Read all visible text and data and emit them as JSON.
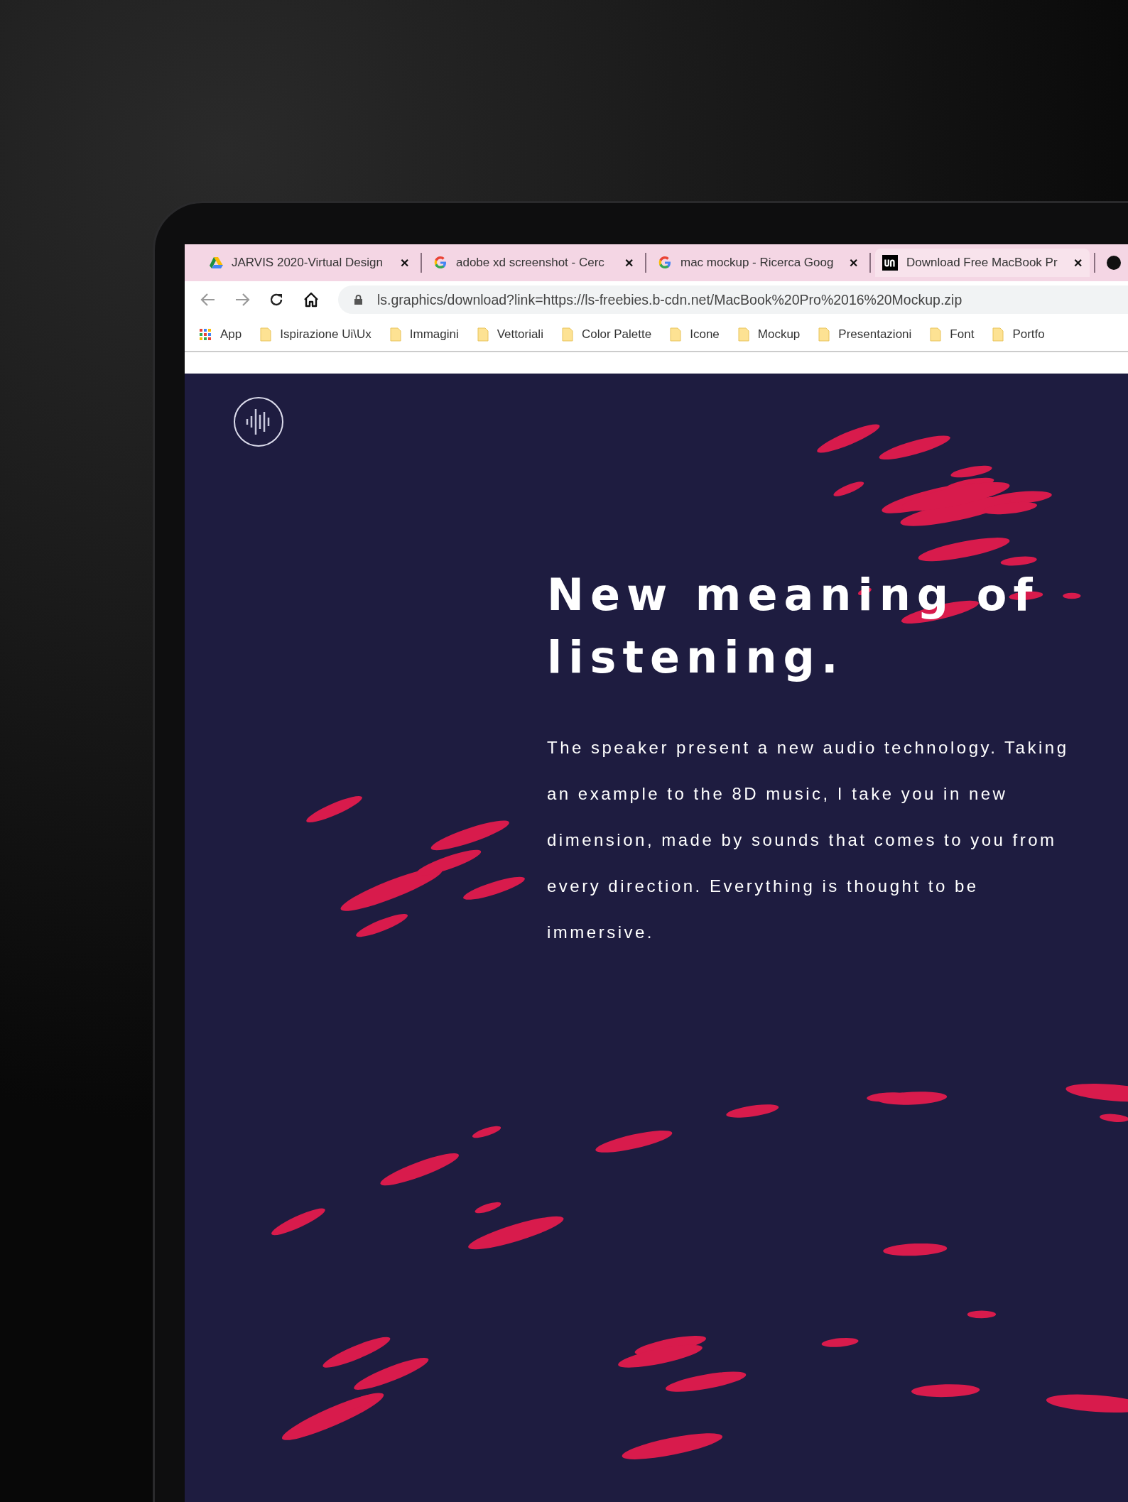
{
  "browser": {
    "tabs": [
      {
        "title": "JARVIS 2020-Virtual Design",
        "close": "✕",
        "selected": false
      },
      {
        "title": "adobe xd screenshot - Cerc",
        "close": "✕",
        "selected": false
      },
      {
        "title": "mac mockup - Ricerca Goog",
        "close": "✕",
        "selected": false
      },
      {
        "title": "Download Free MacBook Pr",
        "close": "✕",
        "selected": true
      },
      {
        "selected": false
      }
    ],
    "url": "ls.graphics/download?link=https://ls-freebies.b-cdn.net/MacBook%20Pro%2016%20Mockup.zip",
    "bookmarks": [
      {
        "label": "App",
        "kind": "apps"
      },
      {
        "label": "Ispirazione Ui\\Ux",
        "kind": "folder"
      },
      {
        "label": "Immagini",
        "kind": "folder"
      },
      {
        "label": "Vettoriali",
        "kind": "folder"
      },
      {
        "label": "Color Palette",
        "kind": "folder"
      },
      {
        "label": "Icone",
        "kind": "folder"
      },
      {
        "label": "Mockup",
        "kind": "folder"
      },
      {
        "label": "Presentazioni",
        "kind": "folder"
      },
      {
        "label": "Font",
        "kind": "folder"
      },
      {
        "label": "Portfo",
        "kind": "folder"
      }
    ]
  },
  "page": {
    "headline": "New meaning of listening.",
    "body": "The speaker present a new audio technology. Taking an example to the 8D music, I take you in new dimension, made by sounds that comes to you from every direction. Everything is thought to be immersive."
  }
}
